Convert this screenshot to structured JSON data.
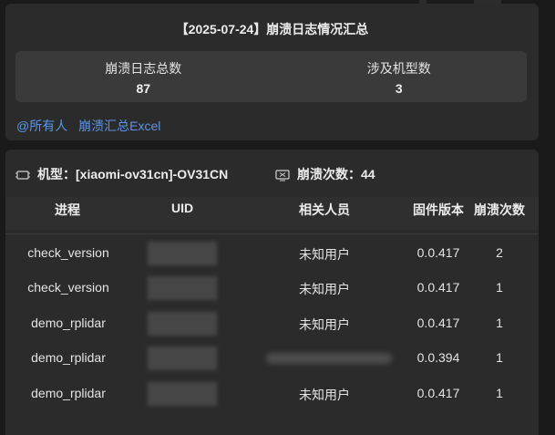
{
  "summary": {
    "title": "【2025-07-24】崩溃日志情况汇总",
    "stats": [
      {
        "label": "崩溃日志总数",
        "value": "87"
      },
      {
        "label": "涉及机型数",
        "value": "3"
      }
    ],
    "links": [
      {
        "text": "@所有人"
      },
      {
        "text": "崩溃汇总Excel"
      }
    ]
  },
  "device": {
    "model_text": "机型：[xiaomi-ov31cn]-OV31CN",
    "crash_text": "崩溃次数：44",
    "icons": {
      "model": "chip-icon",
      "crash": "monitor-crash-icon"
    }
  },
  "table": {
    "headers": [
      "进程",
      "UID",
      "相关人员",
      "固件版本",
      "崩溃次数"
    ],
    "rows": [
      {
        "process": "check_version",
        "person": "未知用户",
        "version": "0.0.417",
        "count": "2"
      },
      {
        "process": "check_version",
        "person": "未知用户",
        "version": "0.0.417",
        "count": "1"
      },
      {
        "process": "demo_rplidar",
        "person": "未知用户",
        "version": "0.0.417",
        "count": "1"
      },
      {
        "process": "demo_rplidar",
        "person": "",
        "version": "0.0.394",
        "count": "1"
      },
      {
        "process": "demo_rplidar",
        "person": "未知用户",
        "version": "0.0.417",
        "count": "1"
      }
    ]
  },
  "colors": {
    "link": "#5a95e8",
    "card": "#2b2b2b",
    "stat_bg": "#3a3a3a"
  }
}
